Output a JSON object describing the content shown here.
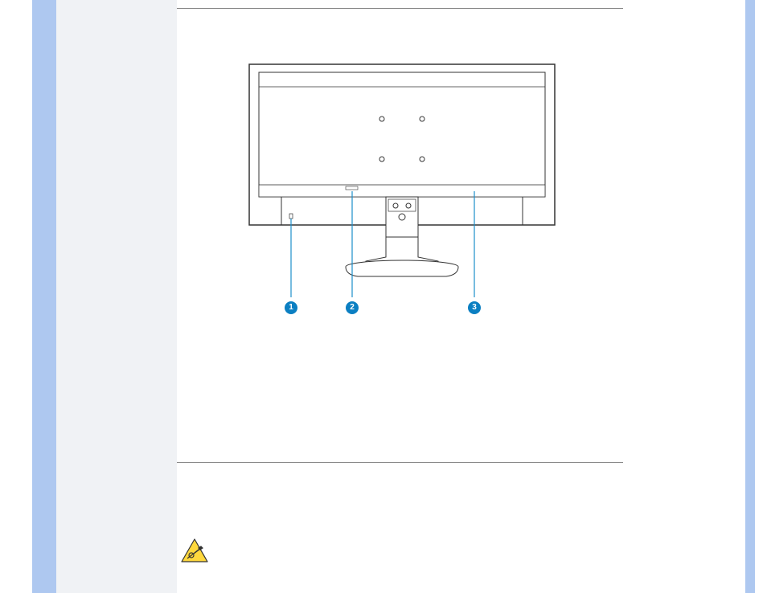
{
  "diagram": {
    "description": "Back view of LCD monitor with stand",
    "callouts": [
      "1",
      "2",
      "3"
    ]
  },
  "icons": {
    "warning": "caution-triangle"
  }
}
